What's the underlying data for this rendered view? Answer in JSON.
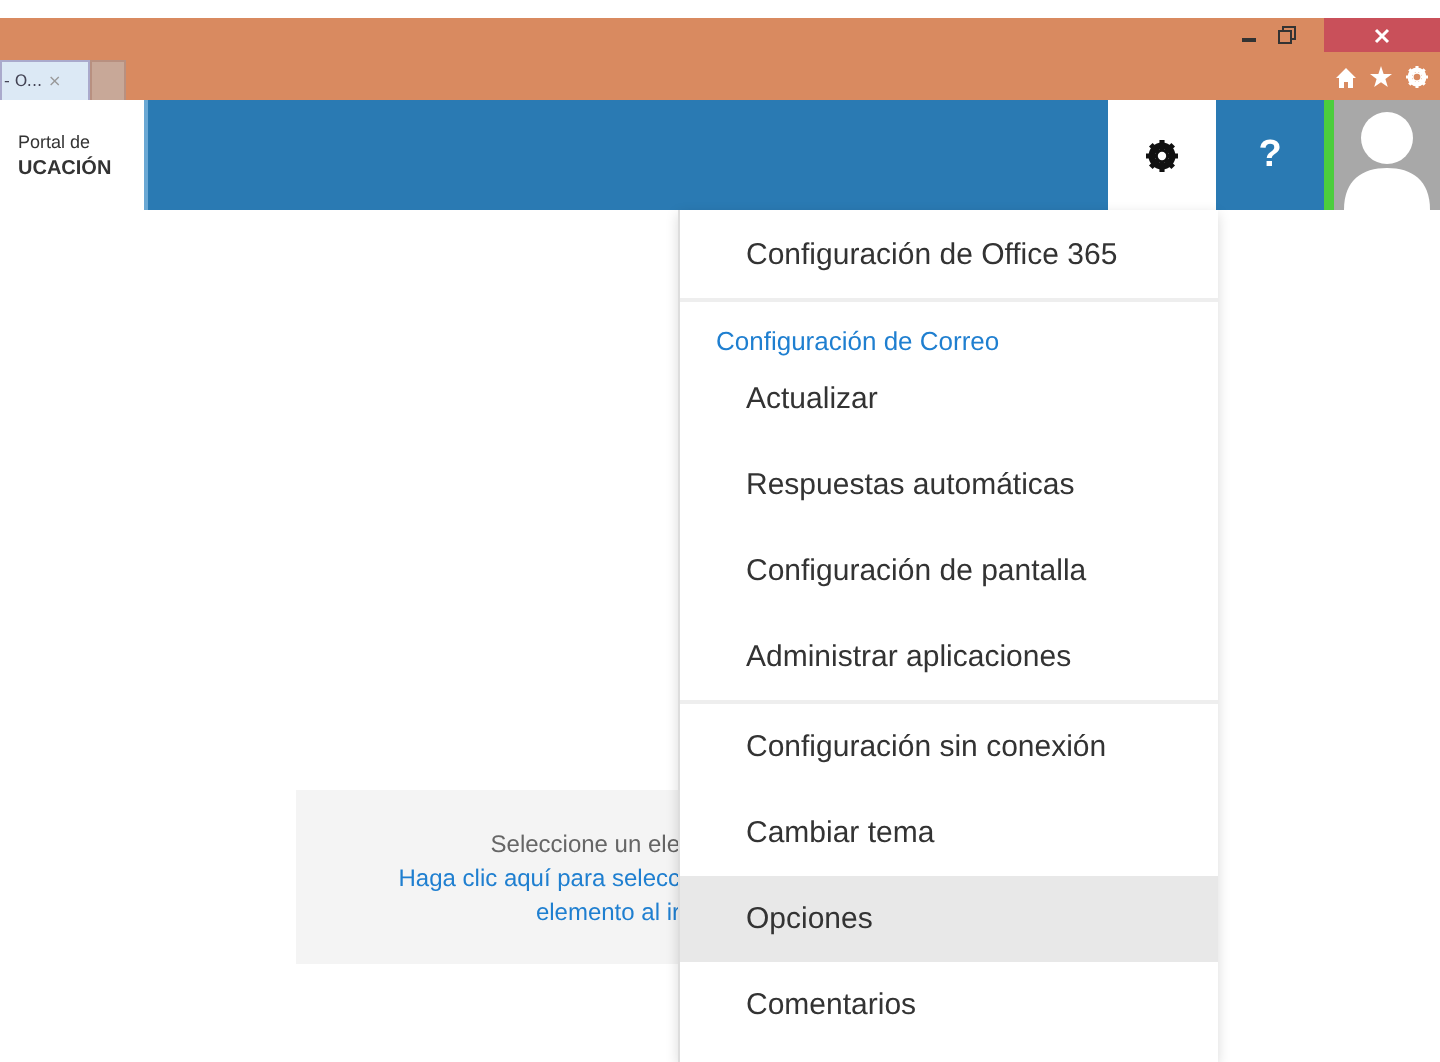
{
  "browser": {
    "tab": {
      "title": "- O...",
      "close": "×"
    }
  },
  "header": {
    "logo": {
      "line1": "Portal de",
      "line2": "UCACIÓN"
    },
    "help": "?"
  },
  "reading_pane": {
    "lines": [
      {
        "text": "Seleccione un ele",
        "kind": "plain"
      },
      {
        "text": "Haga clic aquí para selecc",
        "kind": "link"
      },
      {
        "text": "elemento al ir",
        "kind": "link"
      }
    ]
  },
  "settings_menu": {
    "sections": [
      {
        "items": [
          {
            "label": "Configuración de Office 365",
            "selected": false
          }
        ]
      },
      {
        "header": "Configuración de Correo",
        "items": [
          {
            "label": "Actualizar",
            "selected": false
          },
          {
            "label": "Respuestas automáticas",
            "selected": false
          },
          {
            "label": "Configuración de pantalla",
            "selected": false
          },
          {
            "label": "Administrar aplicaciones",
            "selected": false
          }
        ]
      },
      {
        "items": [
          {
            "label": "Configuración sin conexión",
            "selected": false
          },
          {
            "label": "Cambiar tema",
            "selected": false
          },
          {
            "label": "Opciones",
            "selected": true
          },
          {
            "label": "Comentarios",
            "selected": false
          }
        ]
      }
    ]
  }
}
